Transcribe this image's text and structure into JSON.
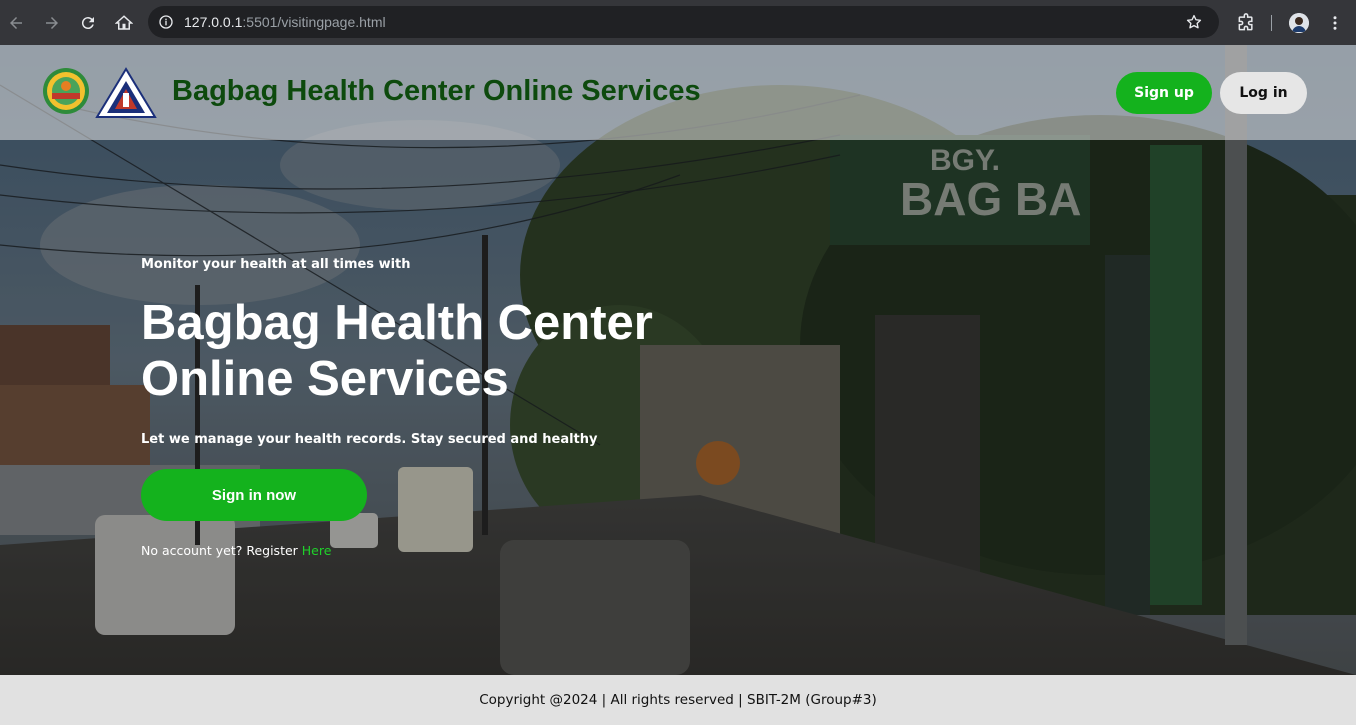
{
  "browser": {
    "url_host": "127.0.0.1",
    "url_path": ":5501/visitingpage.html",
    "icons": [
      "back-icon",
      "forward-icon",
      "reload-icon",
      "home-icon",
      "site-info-icon",
      "bookmark-star-icon",
      "extensions-icon",
      "profile-avatar",
      "menu-kebab-icon"
    ]
  },
  "header": {
    "title": "Bagbag Health Center Online Services",
    "signup_label": "Sign up",
    "login_label": "Log in"
  },
  "hero": {
    "subtitle": "Monitor your health at all times with",
    "title": "Bagbag Health Center Online Services",
    "description": "Let we manage your health records. Stay secured and healthy",
    "cta_label": "Sign in now",
    "register_text": "No account yet? Register ",
    "register_link": "Here"
  },
  "footer": {
    "copyright": "Copyright @2024 | All rights reserved | SBIT-2M (Group#3)"
  },
  "colors": {
    "accent_green": "#14b21d",
    "title_green": "#0d4a0d",
    "chrome_bg": "#35363a",
    "footer_bg": "#e1e1e1"
  }
}
